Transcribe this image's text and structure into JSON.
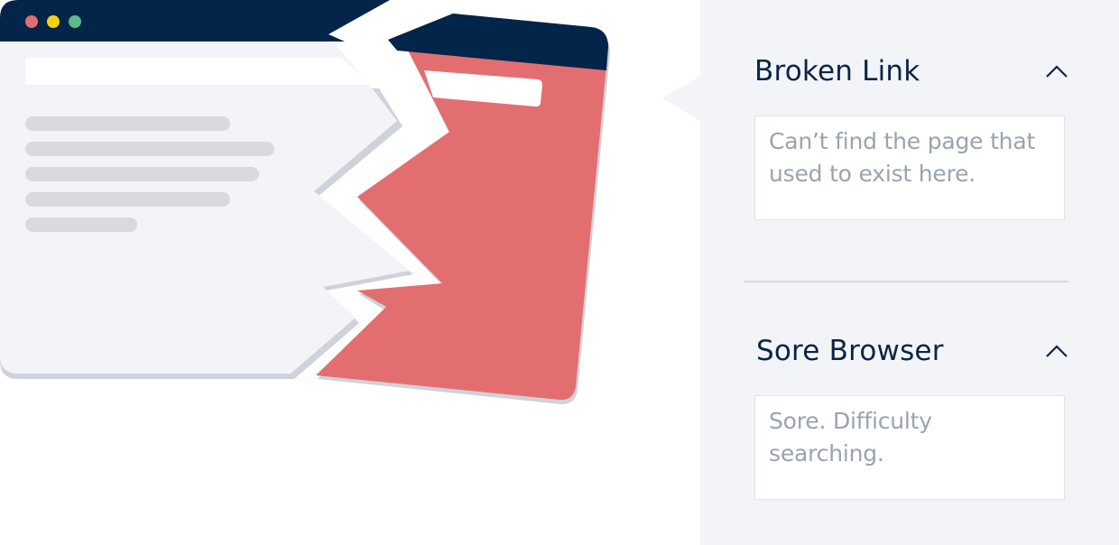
{
  "colors": {
    "navy": "#022549",
    "red": "#e36e70",
    "panel_bg": "#f3f4f8",
    "window_bg": "#f3f4f8",
    "line_grey": "#d9d9de",
    "shadow": "#cfd2da",
    "dot_red": "#e36e70",
    "dot_yellow": "#f5d20f",
    "dot_green": "#5bb98b"
  },
  "illustration": {
    "icons": [
      "broken-browser-window-illustration",
      "window-dot-red-icon",
      "window-dot-yellow-icon",
      "window-dot-green-icon"
    ]
  },
  "accordion": [
    {
      "title": "Broken Link",
      "body": "Can’t find the page that used to exist here.",
      "expanded": true,
      "icon": "chevron-up-icon"
    },
    {
      "title": "Sore Browser",
      "body": "Sore. Difficulty searching.",
      "expanded": true,
      "icon": "chevron-up-icon"
    }
  ]
}
